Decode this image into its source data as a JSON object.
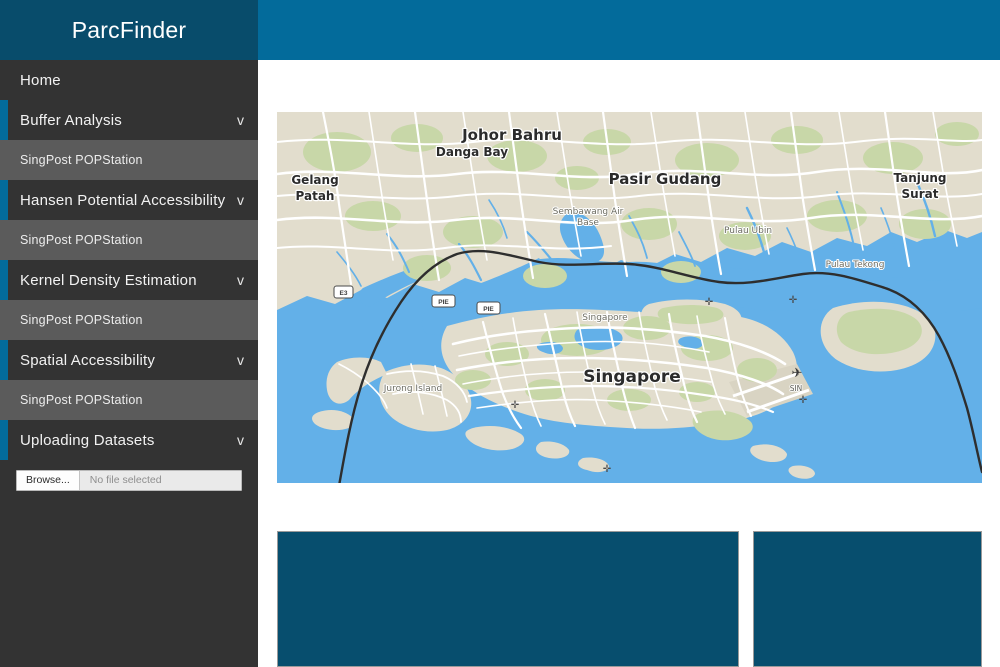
{
  "header": {
    "brand_title": "ParcFinder",
    "brand_bg": "#084c6b",
    "bar_bg": "#036b9b"
  },
  "sidebar": {
    "bg": "#333333",
    "subitem_bg": "#5b5b5b",
    "accent": "#036b9b",
    "items": [
      {
        "label": "Home",
        "type": "plain",
        "chevron": ""
      },
      {
        "label": "Buffer Analysis",
        "type": "parent",
        "chevron": "v"
      },
      {
        "label": "SingPost POPStation",
        "type": "sub"
      },
      {
        "label": "Hansen Potential Accessibility",
        "type": "parent",
        "chevron": "v"
      },
      {
        "label": "SingPost POPStation",
        "type": "sub"
      },
      {
        "label": "Kernel Density Estimation",
        "type": "parent",
        "chevron": "v"
      },
      {
        "label": "SingPost POPStation",
        "type": "sub"
      },
      {
        "label": "Spatial Accessibility",
        "type": "parent",
        "chevron": "v"
      },
      {
        "label": "SingPost POPStation",
        "type": "sub"
      },
      {
        "label": "Uploading Datasets",
        "type": "parent",
        "chevron": "v"
      }
    ],
    "upload": {
      "browse_label": "Browse...",
      "file_placeholder": "No file selected"
    }
  },
  "main": {
    "map": {
      "labels": {
        "johor_bahru": "Johor Bahru",
        "danga_bay": "Danga Bay",
        "gelang_patah": "Gelang Patah",
        "gelang_patah_l1": "Gelang",
        "gelang_patah_l2": "Patah",
        "pasir_gudang": "Pasir Gudang",
        "tanjung_surat_l1": "Tanjung",
        "tanjung_surat_l2": "Surat",
        "sembawang_air_base_l1": "Sembawang Air",
        "sembawang_air_base_l2": "Base",
        "pulau_ubin": "Pulau Ubin",
        "pulau_tekong": "Pulau Tekong",
        "singapore_small": "Singapore",
        "singapore_major": "Singapore",
        "jurong_island": "Jurong Island",
        "airport_code": "SIN",
        "road_e3": "E3",
        "road_pie_1": "PIE",
        "road_pie_2": "PIE"
      },
      "colors": {
        "water": "#63b0e8",
        "land": "#e2ddcd",
        "green": "#c8d7a8",
        "road": "#ffffff",
        "border": "#2e2e2e"
      }
    },
    "panels": {
      "left_panel_label": "",
      "right_panel_label": "",
      "panel_bg": "#074e6e"
    }
  }
}
